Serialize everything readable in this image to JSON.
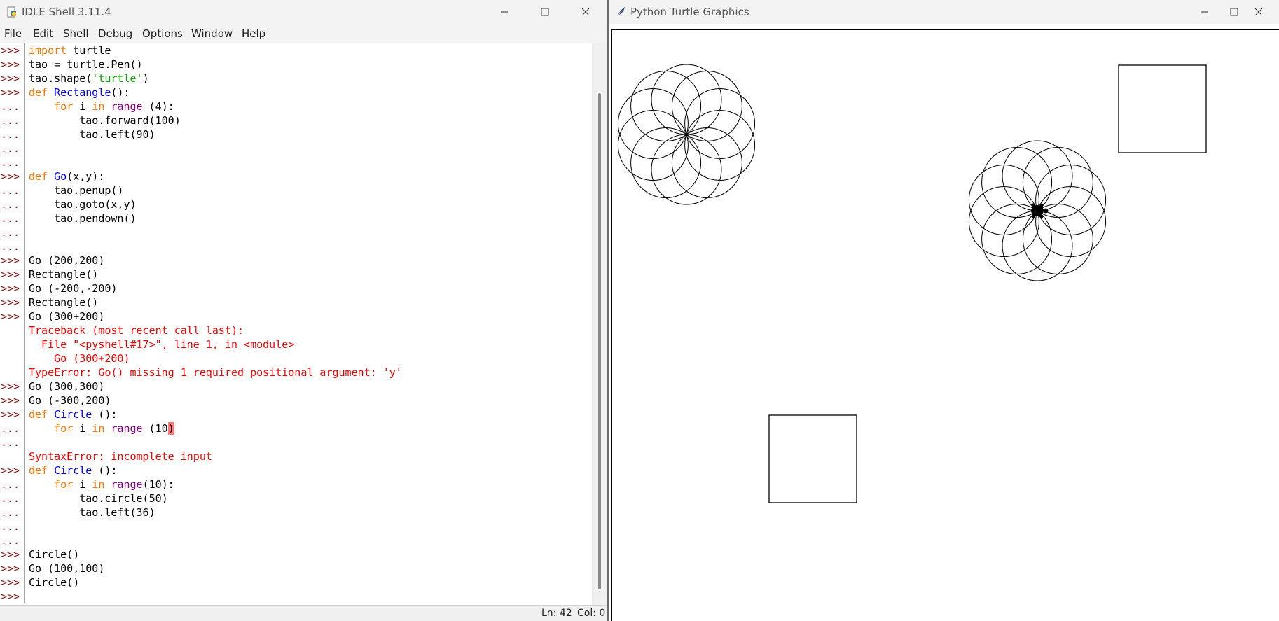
{
  "idle": {
    "title": "IDLE Shell 3.11.4",
    "menu": [
      "File",
      "Edit",
      "Shell",
      "Debug",
      "Options",
      "Window",
      "Help"
    ],
    "lines": [
      {
        "p": ">>>",
        "s": [
          [
            "kw",
            "import"
          ],
          [
            "n",
            " turtle"
          ]
        ]
      },
      {
        "p": ">>>",
        "s": [
          [
            "n",
            "tao = turtle.Pen()"
          ]
        ]
      },
      {
        "p": ">>>",
        "s": [
          [
            "n",
            "tao.shape("
          ],
          [
            "str",
            "'turtle'"
          ],
          [
            "n",
            ")"
          ]
        ]
      },
      {
        "p": ">>>",
        "s": [
          [
            "kw",
            "def"
          ],
          [
            "n",
            " "
          ],
          [
            "def",
            "Rectangle"
          ],
          [
            "n",
            "():"
          ]
        ]
      },
      {
        "p": "...",
        "s": [
          [
            "n",
            "    "
          ],
          [
            "kw",
            "for"
          ],
          [
            "n",
            " i "
          ],
          [
            "kw",
            "in"
          ],
          [
            "n",
            " "
          ],
          [
            "bi",
            "range"
          ],
          [
            "n",
            " (4):"
          ]
        ]
      },
      {
        "p": "...",
        "s": [
          [
            "n",
            "        tao.forward(100)"
          ]
        ]
      },
      {
        "p": "...",
        "s": [
          [
            "n",
            "        tao.left(90)"
          ]
        ]
      },
      {
        "p": "...",
        "s": []
      },
      {
        "p": "...",
        "s": []
      },
      {
        "p": ">>>",
        "s": [
          [
            "kw",
            "def"
          ],
          [
            "n",
            " "
          ],
          [
            "def",
            "Go"
          ],
          [
            "n",
            "(x,y):"
          ]
        ]
      },
      {
        "p": "...",
        "s": [
          [
            "n",
            "    tao.penup()"
          ]
        ]
      },
      {
        "p": "...",
        "s": [
          [
            "n",
            "    tao.goto(x,y)"
          ]
        ]
      },
      {
        "p": "...",
        "s": [
          [
            "n",
            "    tao.pendown()"
          ]
        ]
      },
      {
        "p": "...",
        "s": []
      },
      {
        "p": "...",
        "s": []
      },
      {
        "p": ">>>",
        "s": [
          [
            "n",
            "Go (200,200)"
          ]
        ]
      },
      {
        "p": ">>>",
        "s": [
          [
            "n",
            "Rectangle()"
          ]
        ]
      },
      {
        "p": ">>>",
        "s": [
          [
            "n",
            "Go (-200,-200)"
          ]
        ]
      },
      {
        "p": ">>>",
        "s": [
          [
            "n",
            "Rectangle()"
          ]
        ]
      },
      {
        "p": ">>>",
        "s": [
          [
            "n",
            "Go (300+200)"
          ]
        ]
      },
      {
        "p": "",
        "s": [
          [
            "err",
            "Traceback (most recent call last):"
          ]
        ]
      },
      {
        "p": "",
        "s": [
          [
            "err",
            "  File \"<pyshell#17>\", line 1, in <module>"
          ]
        ]
      },
      {
        "p": "",
        "s": [
          [
            "err",
            "    Go (300+200)"
          ]
        ]
      },
      {
        "p": "",
        "s": [
          [
            "err",
            "TypeError: Go() missing 1 required positional argument: 'y'"
          ]
        ]
      },
      {
        "p": ">>>",
        "s": [
          [
            "n",
            "Go (300,300)"
          ]
        ]
      },
      {
        "p": ">>>",
        "s": [
          [
            "n",
            "Go (-300,200)"
          ]
        ]
      },
      {
        "p": ">>>",
        "s": [
          [
            "kw",
            "def"
          ],
          [
            "n",
            " "
          ],
          [
            "def",
            "Circle"
          ],
          [
            "n",
            " ():"
          ]
        ]
      },
      {
        "p": "...",
        "s": [
          [
            "n",
            "    "
          ],
          [
            "kw",
            "for"
          ],
          [
            "n",
            " i "
          ],
          [
            "kw",
            "in"
          ],
          [
            "n",
            " "
          ],
          [
            "bi",
            "range"
          ],
          [
            "n",
            " (10"
          ],
          [
            "hl",
            ")"
          ]
        ]
      },
      {
        "p": "...",
        "s": []
      },
      {
        "p": "",
        "s": [
          [
            "err",
            "SyntaxError: incomplete input"
          ]
        ]
      },
      {
        "p": ">>>",
        "s": [
          [
            "kw",
            "def"
          ],
          [
            "n",
            " "
          ],
          [
            "def",
            "Circle"
          ],
          [
            "n",
            " ():"
          ]
        ]
      },
      {
        "p": "...",
        "s": [
          [
            "n",
            "    "
          ],
          [
            "kw",
            "for"
          ],
          [
            "n",
            " i "
          ],
          [
            "kw",
            "in"
          ],
          [
            "n",
            " "
          ],
          [
            "bi",
            "range"
          ],
          [
            "n",
            "(10):"
          ]
        ]
      },
      {
        "p": "...",
        "s": [
          [
            "n",
            "        tao.circle(50)"
          ]
        ]
      },
      {
        "p": "...",
        "s": [
          [
            "n",
            "        tao.left(36)"
          ]
        ]
      },
      {
        "p": "...",
        "s": []
      },
      {
        "p": "...",
        "s": []
      },
      {
        "p": ">>>",
        "s": [
          [
            "n",
            "Circle()"
          ]
        ]
      },
      {
        "p": ">>>",
        "s": [
          [
            "n",
            "Go (100,100)"
          ]
        ]
      },
      {
        "p": ">>>",
        "s": [
          [
            "n",
            "Circle()"
          ]
        ]
      },
      {
        "p": ">>>",
        "s": []
      }
    ],
    "status": {
      "ln": "Ln: 42",
      "col": "Col: 0"
    }
  },
  "turtle": {
    "title": "Python Turtle Graphics"
  },
  "colors": {
    "keyword": "#ff7700",
    "builtin": "#900090",
    "definition": "#0000ff",
    "string": "#00aa00",
    "error": "#ff0000",
    "prompt": "#8b1a1a"
  }
}
